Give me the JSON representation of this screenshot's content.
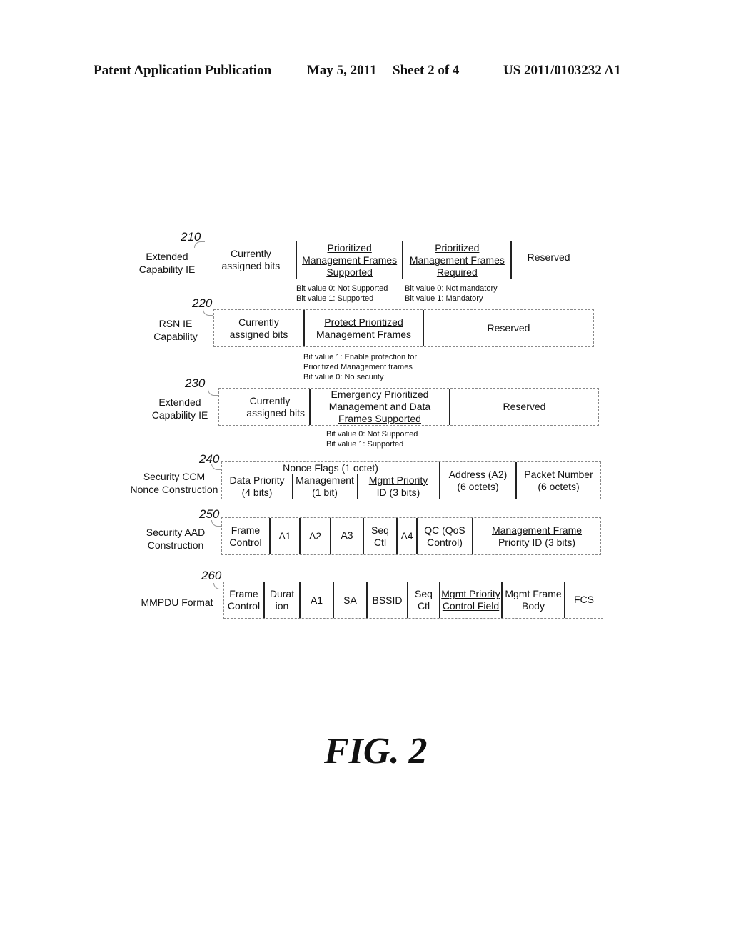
{
  "header": {
    "publication": "Patent Application Publication",
    "date": "May 5, 2011",
    "sheet": "Sheet 2 of 4",
    "number": "US 2011/0103232 A1"
  },
  "figure_label": "FIG. 2",
  "rows": [
    {
      "ref": "210",
      "label_lines": [
        "Extended",
        "Capability IE"
      ],
      "cells": [
        {
          "lines": [
            "Currently",
            "assigned bits"
          ],
          "underline": false
        },
        {
          "lines": [
            "Prioritized",
            "Management Frames",
            "Supported"
          ],
          "underline": true
        },
        {
          "lines": [
            "Prioritized",
            "Management Frames",
            "Required"
          ],
          "underline": true
        },
        {
          "lines": [
            "Reserved"
          ],
          "underline": false
        }
      ],
      "notes": [
        {
          "lines": [
            "Bit value 0: Not Supported",
            "Bit value 1: Supported"
          ]
        },
        {
          "lines": [
            "Bit value 0: Not mandatory",
            "Bit value 1: Mandatory"
          ]
        }
      ]
    },
    {
      "ref": "220",
      "label_lines": [
        "RSN IE",
        "Capability"
      ],
      "cells": [
        {
          "lines": [
            "Currently",
            "assigned bits"
          ],
          "underline": false
        },
        {
          "lines": [
            "Protect Prioritized",
            "Management Frames"
          ],
          "underline": true
        },
        {
          "lines": [
            "Reserved"
          ],
          "underline": false
        }
      ],
      "notes": [
        {
          "lines": [
            "Bit value 1: Enable protection for",
            "Prioritized Management frames",
            "Bit value 0: No security"
          ]
        }
      ]
    },
    {
      "ref": "230",
      "label_lines": [
        "Extended",
        "Capability IE"
      ],
      "cells": [
        {
          "lines": [
            "Currently",
            "assigned bits"
          ],
          "underline": false
        },
        {
          "lines": [
            "Emergency Prioritized",
            "Management and Data",
            "Frames Supported"
          ],
          "underline": true
        },
        {
          "lines": [
            "Reserved"
          ],
          "underline": false
        }
      ],
      "notes": [
        {
          "lines": [
            "Bit value 0: Not Supported",
            "Bit value 1: Supported"
          ]
        }
      ]
    },
    {
      "ref": "240",
      "label_lines": [
        "Security CCM",
        "Nonce Construction"
      ],
      "group_header": "Nonce Flags (1 octet)",
      "cells": [
        {
          "lines": [
            "Data Priority",
            "(4 bits)"
          ],
          "underline": false
        },
        {
          "lines": [
            "Management",
            "(1 bit)"
          ],
          "underline": false
        },
        {
          "lines": [
            "Mgmt Priority",
            "ID (3 bits)"
          ],
          "underline": true
        },
        {
          "lines": [
            "Address (A2)",
            "(6 octets)"
          ],
          "underline": false
        },
        {
          "lines": [
            "Packet Number",
            "(6 octets)"
          ],
          "underline": false
        }
      ]
    },
    {
      "ref": "250",
      "label_lines": [
        "Security AAD",
        "Construction"
      ],
      "cells": [
        {
          "lines": [
            "Frame",
            "Control"
          ],
          "underline": false
        },
        {
          "lines": [
            "A1"
          ],
          "underline": false
        },
        {
          "lines": [
            "A2"
          ],
          "underline": false
        },
        {
          "lines": [
            "A3"
          ],
          "underline": false
        },
        {
          "lines": [
            "Seq",
            "Ctl"
          ],
          "underline": false
        },
        {
          "lines": [
            "A4"
          ],
          "underline": false
        },
        {
          "lines": [
            "QC (QoS",
            "Control)"
          ],
          "underline": false
        },
        {
          "lines": [
            "Management Frame",
            "Priority ID (3 bits)"
          ],
          "underline": true
        }
      ]
    },
    {
      "ref": "260",
      "label_lines": [
        "MMPDU Format"
      ],
      "cells": [
        {
          "lines": [
            "Frame",
            "Control"
          ],
          "underline": false
        },
        {
          "lines": [
            "Durat",
            "ion"
          ],
          "underline": false
        },
        {
          "lines": [
            "A1"
          ],
          "underline": false
        },
        {
          "lines": [
            "SA"
          ],
          "underline": false
        },
        {
          "lines": [
            "BSSID"
          ],
          "underline": false
        },
        {
          "lines": [
            "Seq",
            "Ctl"
          ],
          "underline": false
        },
        {
          "lines": [
            "Mgmt Priority",
            "Control Field"
          ],
          "underline": true
        },
        {
          "lines": [
            "Mgmt Frame",
            "Body"
          ],
          "underline": false
        },
        {
          "lines": [
            "FCS"
          ],
          "underline": false
        }
      ]
    }
  ]
}
